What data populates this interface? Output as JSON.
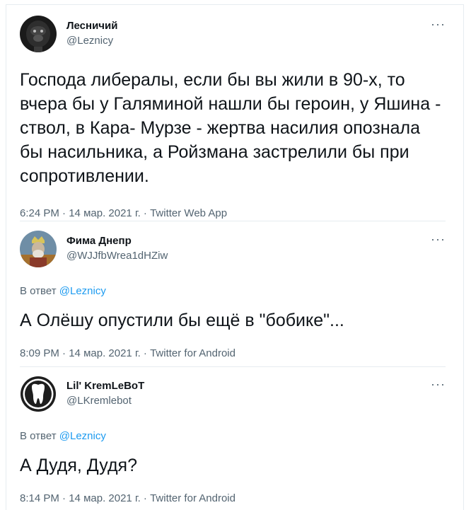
{
  "colors": {
    "text": "#0f1419",
    "secondary": "#536471",
    "accent": "#1d9bf0",
    "divider": "#e6ecf0"
  },
  "tweets": [
    {
      "name": "Лесничий",
      "handle": "@Leznicy",
      "avatar_icon": "gorilla-avatar",
      "text": "Господа либералы, если бы вы жили в 90-х, то вчера бы у Галяминой нашли бы героин, у Яшина - ствол, в Кара- Мурзе - жертва насилия опознала бы насильника, а Ройзмана застрелили бы при сопротивлении.",
      "time": "6:24 PM",
      "sep": " · ",
      "date": "14 мар. 2021 г.",
      "source": "Twitter Web App"
    },
    {
      "name": "Фима Днепр",
      "handle": "@WJJfbWrea1dHZiw",
      "avatar_icon": "king-avatar",
      "reply_label": "В ответ",
      "reply_to": "@Leznicy",
      "text": "А Олёшу опустили бы ещё в \"бобике\"...",
      "time": "8:09 PM",
      "sep": " · ",
      "date": "14 мар. 2021 г.",
      "source": "Twitter for Android"
    },
    {
      "name": "Lil' KremLeBoT",
      "handle": "@LKremlebot",
      "avatar_icon": "tooth-avatar",
      "reply_label": "В ответ",
      "reply_to": "@Leznicy",
      "text": "А Дудя, Дудя?",
      "time": "8:14 PM",
      "sep": " · ",
      "date": "14 мар. 2021 г.",
      "source": "Twitter for Android"
    }
  ],
  "more_label": "···"
}
